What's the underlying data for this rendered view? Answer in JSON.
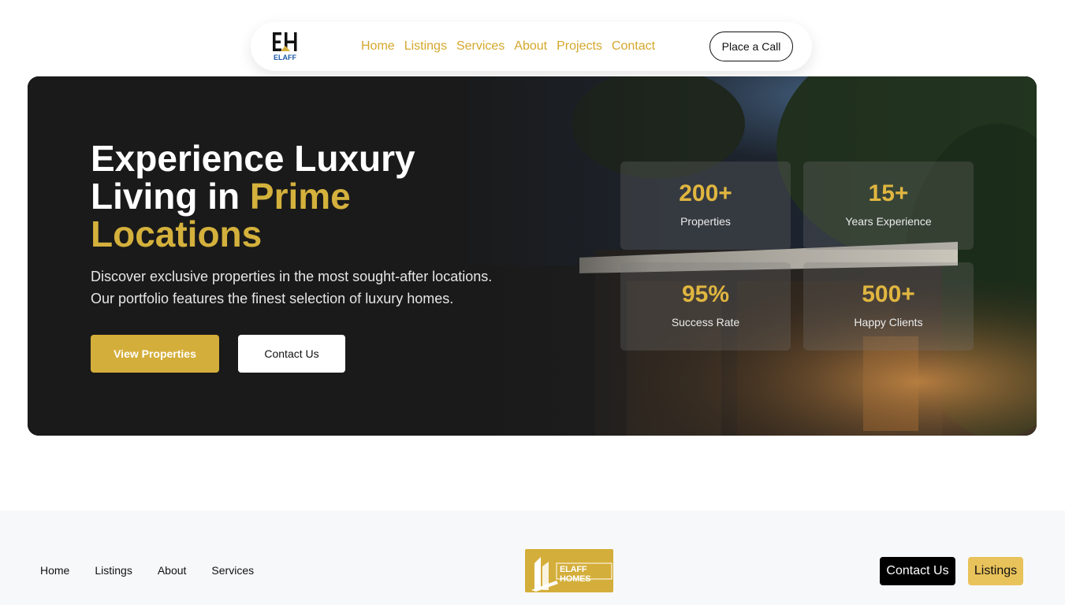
{
  "nav": {
    "logo": "EH ELAFF",
    "links": [
      "Home",
      "Listings",
      "Services",
      "About",
      "Projects",
      "Contact"
    ],
    "call_button": "Place a Call"
  },
  "hero": {
    "title_line1": "Experience Luxury",
    "title_line2_white": "Living in ",
    "title_line2_gold": "Prime",
    "title_line3_gold": "Locations",
    "description_line1": "Discover exclusive properties in the most sought-after locations.",
    "description_line2": "Our portfolio features the finest selection of luxury homes.",
    "primary_button": "View Properties",
    "secondary_button": "Contact Us",
    "stats": [
      {
        "value": "200+",
        "label": "Properties"
      },
      {
        "value": "15+",
        "label": "Years Experience"
      },
      {
        "value": "95%",
        "label": "Success Rate"
      },
      {
        "value": "500+",
        "label": "Happy Clients"
      }
    ]
  },
  "footer": {
    "links": [
      "Home",
      "Listings",
      "About",
      "Services"
    ],
    "logo_text": "ELAFF HOMES",
    "contact_button": "Contact Us",
    "listings_button": "Listings"
  },
  "colors": {
    "gold": "#d4ae3a",
    "dark": "#1b1b1b"
  }
}
